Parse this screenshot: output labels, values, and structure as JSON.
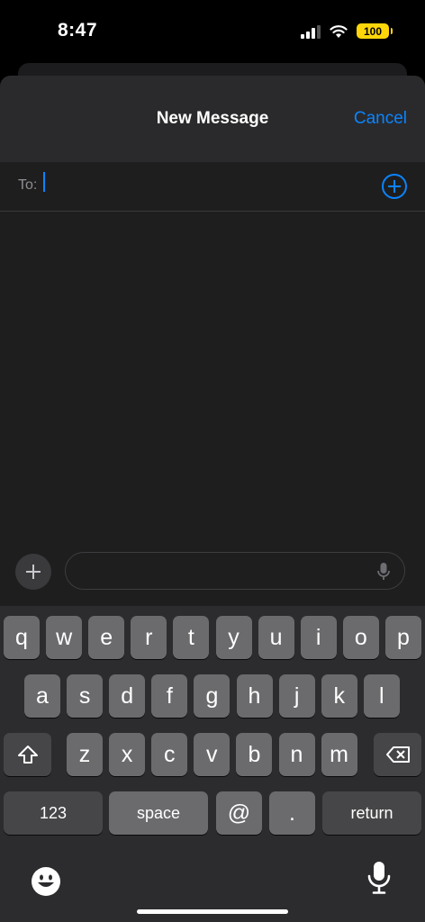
{
  "status_bar": {
    "time": "8:47",
    "battery": "100"
  },
  "sheet": {
    "title": "New Message",
    "cancel_label": "Cancel"
  },
  "recipient": {
    "label": "To:"
  },
  "keyboard": {
    "row1": [
      "q",
      "w",
      "e",
      "r",
      "t",
      "y",
      "u",
      "i",
      "o",
      "p"
    ],
    "row2": [
      "a",
      "s",
      "d",
      "f",
      "g",
      "h",
      "j",
      "k",
      "l"
    ],
    "row3": [
      "z",
      "x",
      "c",
      "v",
      "b",
      "n",
      "m"
    ],
    "numbers_label": "123",
    "space_label": "space",
    "at_label": "@",
    "dot_label": ".",
    "return_label": "return"
  },
  "icons": {
    "shift": "shift-icon",
    "delete": "backspace-icon",
    "emoji": "emoji-icon",
    "dictation": "microphone-icon",
    "add": "plus-icon"
  },
  "colors": {
    "accent": "#0a84ff",
    "battery": "#ffd60a"
  }
}
